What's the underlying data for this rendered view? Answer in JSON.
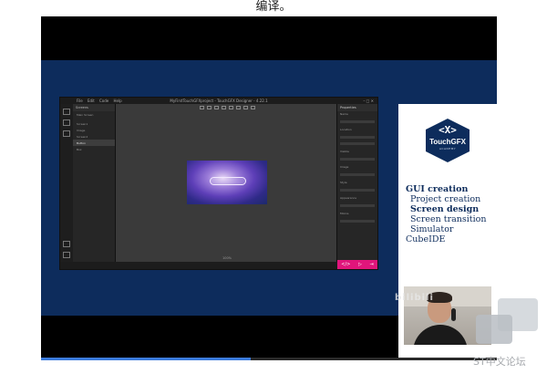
{
  "page": {
    "caption_top": "编译。"
  },
  "app": {
    "title": "MyFirstTouchGFXproject - TouchGFX Designer - 4.22.1",
    "menu": [
      "File",
      "Edit",
      "Code",
      "Help"
    ],
    "window_buttons": "–  □  ✕",
    "screens_panel": {
      "header": "Screens",
      "rows": [
        "Main Screen",
        "",
        "Screen1",
        "Image",
        "Screen2",
        "Button",
        "Box"
      ],
      "selected_index": 5
    },
    "properties_panel": {
      "header": "Properties",
      "labels": [
        "Name",
        "Location",
        "Visible",
        "Image",
        "Style",
        "Appearance",
        "Mixins"
      ]
    },
    "zoom": "100%",
    "pink_bar": [
      "</>",
      "▷",
      "⇥"
    ]
  },
  "side_panel": {
    "logo": {
      "mark": "<X>",
      "name": "TouchGFX",
      "sub": "ACADEMY"
    },
    "menu": [
      {
        "label": "GUI creation",
        "level": "heading",
        "active": true
      },
      {
        "label": "Project creation",
        "level": "sub",
        "active": false
      },
      {
        "label": "Screen design",
        "level": "sub",
        "active": true
      },
      {
        "label": "Screen transition",
        "level": "sub",
        "active": false
      },
      {
        "label": "Simulator",
        "level": "sub",
        "active": false
      },
      {
        "label": "CubeIDE",
        "level": "heading",
        "active": false
      }
    ]
  },
  "watermark": {
    "text": "ST中文论坛",
    "brand": "bilibili"
  },
  "video": {
    "progress_percent": 46
  },
  "colors": {
    "background_blue": "#0d2c5c",
    "accent_pink": "#e0157b",
    "menu_text": "#0d2c5c"
  }
}
